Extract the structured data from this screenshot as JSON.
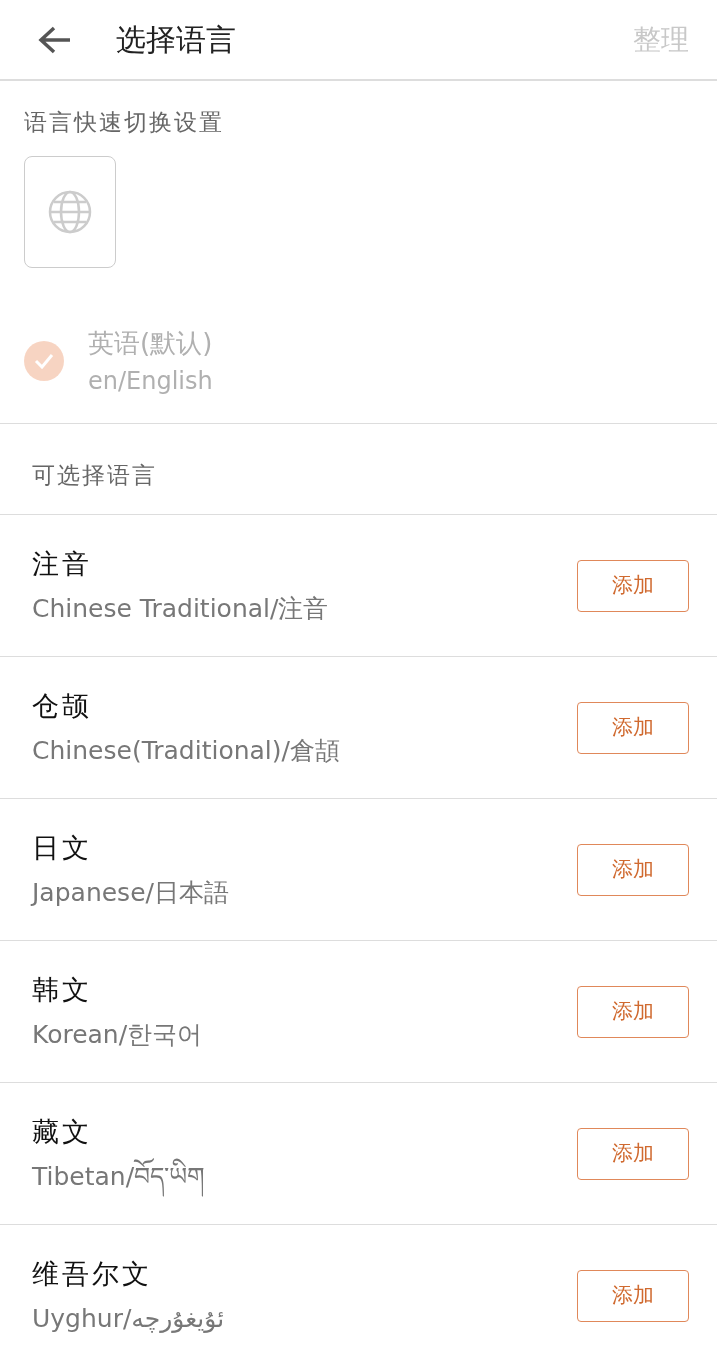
{
  "header": {
    "title": "选择语言",
    "action": {
      "label": "整理",
      "disabled": true
    }
  },
  "quick_switch": {
    "heading": "语言快速切换设置"
  },
  "default_language": {
    "name": "英语(默认)",
    "code": "en/English",
    "checked": true,
    "disabled": true
  },
  "available": {
    "heading": "可选择语言",
    "languages": [
      {
        "name": "注音",
        "subtitle": "Chinese Traditional/注音",
        "button": "添加"
      },
      {
        "name": "仓颉",
        "subtitle": "Chinese(Traditional)/倉頡",
        "button": "添加"
      },
      {
        "name": "日文",
        "subtitle": "Japanese/日本語",
        "button": "添加"
      },
      {
        "name": "韩文",
        "subtitle": "Korean/한국어",
        "button": "添加"
      },
      {
        "name": "藏文",
        "subtitle": "Tibetan/བོད་ཡིག",
        "button": "添加"
      },
      {
        "name": "维吾尔文",
        "subtitle": "Uyghur/ئۇيغۇرچە",
        "button": "添加"
      }
    ]
  }
}
